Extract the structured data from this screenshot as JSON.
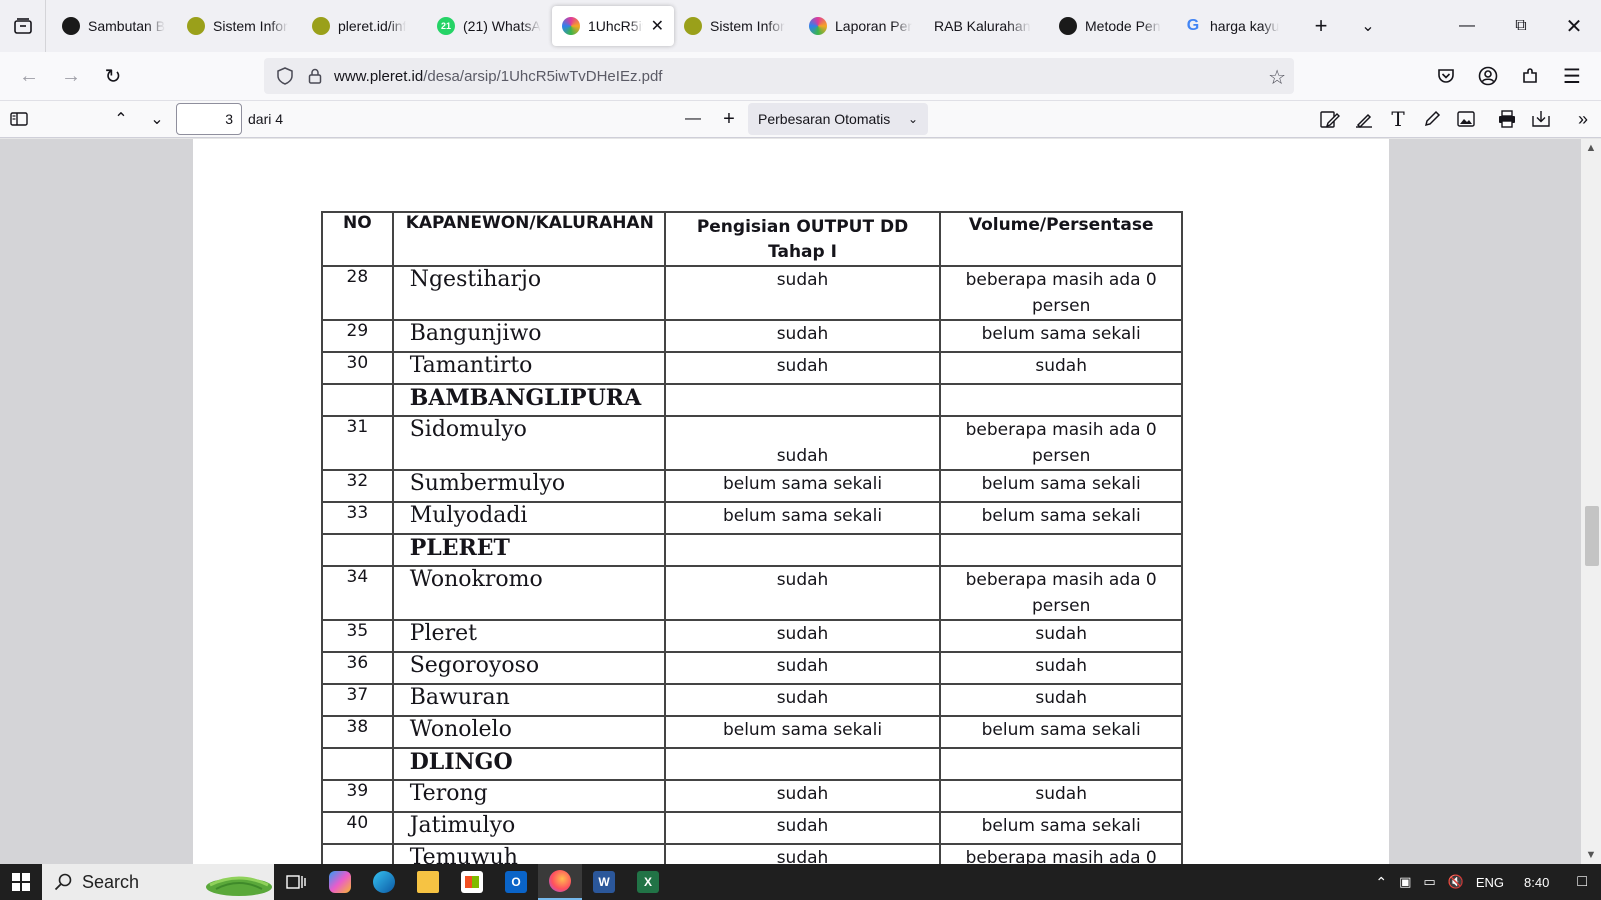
{
  "tabs": [
    {
      "label": "Sambutan B",
      "icon": "globe-dark-icon",
      "color": "#1a1a1a"
    },
    {
      "label": "Sistem Infor",
      "icon": "emblem-icon",
      "color": "#9aa01a"
    },
    {
      "label": "pleret.id/inf",
      "icon": "emblem-icon",
      "color": "#9aa01a"
    },
    {
      "label": "(21) WhatsA",
      "icon": "whatsapp-icon",
      "color": "#25d366",
      "badge": "21"
    },
    {
      "label": "1UhcR5iv",
      "icon": "pinwheel-icon",
      "color": "#e0399a",
      "active": true
    },
    {
      "label": "Sistem Infor",
      "icon": "emblem-icon",
      "color": "#9aa01a"
    },
    {
      "label": "Laporan Per",
      "icon": "pinwheel-icon",
      "color": "#e0399a"
    },
    {
      "label": "RAB Kalurahan",
      "icon": "none"
    },
    {
      "label": "Metode Pen",
      "icon": "globe-dark-icon",
      "color": "#1a1a1a"
    },
    {
      "label": "harga kayu",
      "icon": "google-icon",
      "color": "#4285f4"
    }
  ],
  "url": {
    "host": "www.pleret.id",
    "path": "/desa/arsip/1UhcR5iwTvDHeIEz.pdf"
  },
  "pdf": {
    "page": "3",
    "of_label": "dari 4",
    "zoom": "Perbesaran Otomatis"
  },
  "table": {
    "headers": {
      "no": "NO",
      "name": "KAPANEWON/KALURAHAN",
      "output_line1": "Pengisian OUTPUT DD",
      "output_line2": "Tahap I",
      "volume": "Volume/Persentase"
    },
    "rows": [
      {
        "no": "28",
        "name": "Ngestiharjo",
        "output": "sudah",
        "volume": "beberapa masih ada 0 persen",
        "tall": true
      },
      {
        "no": "29",
        "name": "Bangunjiwo",
        "output": "sudah",
        "volume": "belum sama sekali"
      },
      {
        "no": "30",
        "name": "Tamantirto",
        "output": "sudah",
        "volume": "sudah"
      },
      {
        "no": "",
        "name": "BAMBANGLIPURA",
        "output": "",
        "volume": "",
        "group": true
      },
      {
        "no": "31",
        "name": "Sidomulyo",
        "output": "sudah",
        "volume": "beberapa masih ada 0 persen",
        "tall": true,
        "output_bottom": true
      },
      {
        "no": "32",
        "name": "Sumbermulyo",
        "output": "belum sama sekali",
        "volume": "belum sama sekali"
      },
      {
        "no": "33",
        "name": "Mulyodadi",
        "output": "belum sama sekali",
        "volume": "belum sama sekali"
      },
      {
        "no": "",
        "name": "PLERET",
        "output": "",
        "volume": "",
        "group": true
      },
      {
        "no": "34",
        "name": "Wonokromo",
        "output": "sudah",
        "volume": "beberapa masih ada 0 persen",
        "tall": true
      },
      {
        "no": "35",
        "name": "Pleret",
        "output": "sudah",
        "volume": "sudah"
      },
      {
        "no": "36",
        "name": "Segoroyoso",
        "output": "sudah",
        "volume": "sudah"
      },
      {
        "no": "37",
        "name": "Bawuran",
        "output": "sudah",
        "volume": "sudah"
      },
      {
        "no": "38",
        "name": "Wonolelo",
        "output": "belum sama sekali",
        "volume": "belum sama sekali"
      },
      {
        "no": "",
        "name": "DLINGO",
        "output": "",
        "volume": "",
        "group": true
      },
      {
        "no": "39",
        "name": "Terong",
        "output": "sudah",
        "volume": "sudah"
      },
      {
        "no": "40",
        "name": "Jatimulyo",
        "output": "sudah",
        "volume": "belum sama sekali"
      },
      {
        "no": "",
        "name": "Temuwuh",
        "output": "sudah",
        "volume": "beberapa masih ada 0",
        "tall": true
      }
    ]
  },
  "taskbar": {
    "search_label": "Search",
    "lang": "ENG",
    "time": "8:40"
  }
}
